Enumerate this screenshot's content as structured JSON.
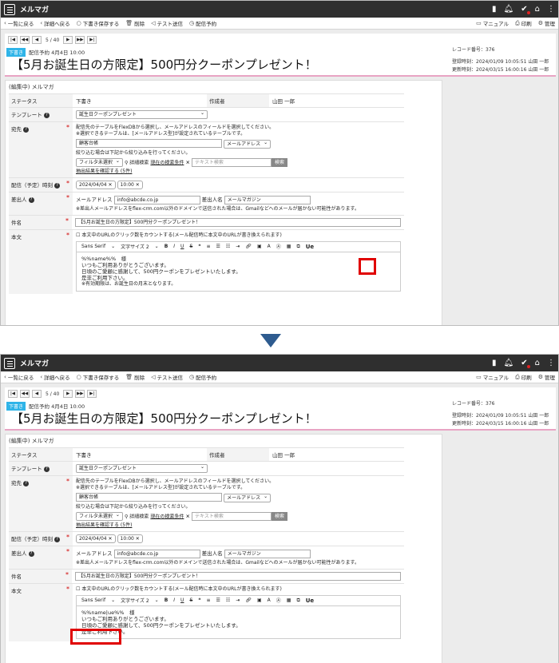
{
  "app": {
    "title": "メルマガ"
  },
  "toolbar": {
    "back": "一覧に戻る",
    "detail": "詳細へ戻る",
    "save_draft": "下書き保存する",
    "delete": "削除",
    "test_send": "テスト送信",
    "schedule_send": "配信予約",
    "manual": "マニュアル",
    "print": "印刷",
    "admin": "管理"
  },
  "pager": {
    "count": "5 / 40"
  },
  "record": {
    "badge": "下書き",
    "schedule": "配信予約 4月4日 10:00",
    "title": "【5月お誕生日の方限定】500円分クーポンプレゼント！",
    "record_no": "レコード番号：376",
    "registered": "登録時刻：2024/01/09 10:05:51 山田 一郎",
    "updated": "更新時刻：2024/03/15 16:00:16 山田 一郎"
  },
  "form": {
    "heading": "(編集中) メルマガ",
    "status_label": "ステータス",
    "status_value": "下書き",
    "author_label": "作成者",
    "author_value": "山田 一郎",
    "template_label": "テンプレート",
    "template_value": "誕生日クーポンプレゼント",
    "dest_label": "宛先",
    "dest_note1": "配信先のテーブルをFlexDBから選択し、メールアドレスのフィールドを選択してください。",
    "dest_note2": "※選択できるテーブルは、[メールアドレス型]が設定されているテーブルです。",
    "dest_table": "顧客台帳",
    "dest_field": "メールアドレス",
    "filter_note": "絞り込む場合は下記から絞り込みを行ってください。",
    "filter_select": "フィルタ未選択",
    "detail_search": "詳細検索",
    "current_condition": "現在の検索条件",
    "text_search_placeholder": "テキスト検索",
    "search_button": "検索",
    "extract_link": "抽出結果を確認する (5件)",
    "schedule_label": "配信（予定）時刻",
    "date_value": "2024/04/04",
    "time_value": "10:00",
    "sender_label": "差出人",
    "sender_email_label": "メールアドレス",
    "sender_email": "info@abcde.co.jp",
    "sender_name_label": "差出人名",
    "sender_name": "メールマガジン",
    "sender_note": "※差出人メールアドレスをflex-crm.com以外のドメインで送信された場合は、Gmailなどへのメールが届かない可能性があります。",
    "subject_label": "件名",
    "subject_value": "【5月お誕生日の方限定】500円分クーポンプレゼント！",
    "body_label": "本文",
    "click_count": "本文中のURLのクリック数をカウントする(メール配信時に本文中のURLが書き換えられます)",
    "font_select": "Sans Serif",
    "size_select": "文字サイズ 2",
    "ue_button": "Ue",
    "body_line1_top": "%%name%%　様",
    "body_line1_bottom_inserted": "%%name|ue%%",
    "body_line1_bottom_rest": "様",
    "body_line2": "いつもご利用ありがとうございます。",
    "body_line3": "日頃のご愛顧に感謝して、500円クーポンをプレゼントいたします。",
    "body_line4": "是非ご利用下さい。",
    "body_line5": "※有効期限は、お誕生日の月末となります。"
  }
}
